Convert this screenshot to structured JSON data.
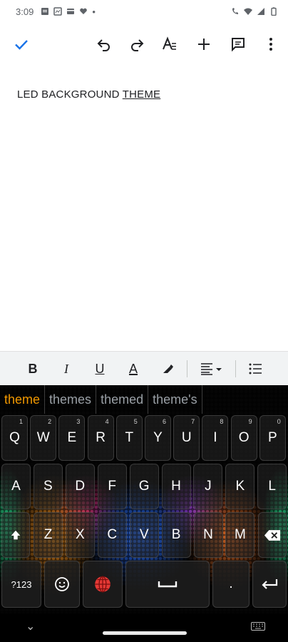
{
  "status": {
    "time": "3:09",
    "dot": "•"
  },
  "toolbar": {
    "check": "check-icon",
    "undo": "undo-icon",
    "redo": "redo-icon",
    "text_format": "text-format-icon",
    "insert": "plus-icon",
    "comment": "comment-icon",
    "more": "more-vert-icon"
  },
  "document": {
    "text_plain": "LED BACKGROUND ",
    "text_underlined": "THEME"
  },
  "format": {
    "bold": "B",
    "italic": "I",
    "underline": "U",
    "text_color": "A"
  },
  "keyboard": {
    "suggestions": [
      "theme",
      "themes",
      "themed",
      "theme's"
    ],
    "row1": [
      {
        "k": "Q",
        "h": "1"
      },
      {
        "k": "W",
        "h": "2"
      },
      {
        "k": "E",
        "h": "3"
      },
      {
        "k": "R",
        "h": "4"
      },
      {
        "k": "T",
        "h": "5"
      },
      {
        "k": "Y",
        "h": "6"
      },
      {
        "k": "U",
        "h": "7"
      },
      {
        "k": "I",
        "h": "8"
      },
      {
        "k": "O",
        "h": "9"
      },
      {
        "k": "P",
        "h": "0"
      }
    ],
    "row2": [
      "A",
      "S",
      "D",
      "F",
      "G",
      "H",
      "J",
      "K",
      "L"
    ],
    "row3": [
      "Z",
      "X",
      "C",
      "V",
      "B",
      "N",
      "M"
    ],
    "symbols_label": "?123",
    "period": "."
  },
  "colors": {
    "accent": "#1a73e8",
    "suggestion_active": "#f29900",
    "emoji_globe": "#e53935"
  }
}
